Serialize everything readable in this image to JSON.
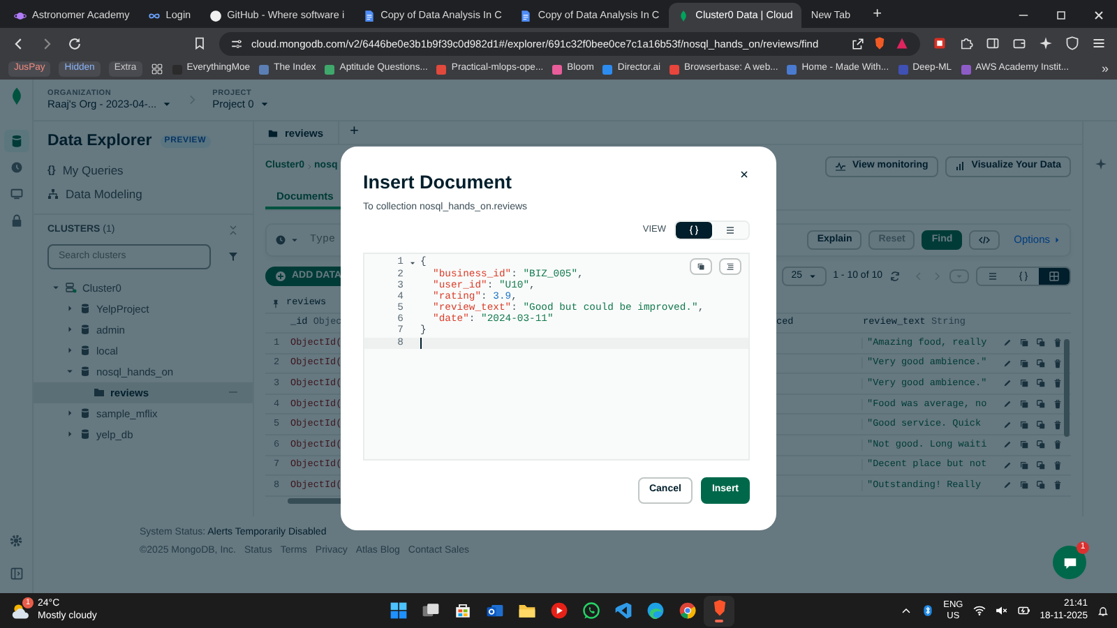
{
  "browser": {
    "tabs": [
      {
        "title": "Astronomer Academy",
        "kind": "astro",
        "selected": false
      },
      {
        "title": "Login",
        "kind": "login",
        "selected": false
      },
      {
        "title": "GitHub - Where software i",
        "kind": "github",
        "selected": false
      },
      {
        "title": "Copy of Data Analysis In C",
        "kind": "doc",
        "selected": false
      },
      {
        "title": "Copy of Data Analysis In C",
        "kind": "doc",
        "selected": false
      },
      {
        "title": "Cluster0 Data | Cloud",
        "kind": "mongo",
        "selected": true
      },
      {
        "title": "New Tab",
        "kind": "blank",
        "selected": false
      }
    ],
    "new_tab": "+",
    "url": "cloud.mongodb.com/v2/6446be0e3b1b9f39c0d982d1#/explorer/691c32f0bee0ce7c1a16b53f/nosql_hands_on/reviews/find",
    "bookmark_tags": [
      {
        "label": "JusPay",
        "color": "#f28b82"
      },
      {
        "label": "Hidden",
        "color": "#8ab4f8"
      },
      {
        "label": "Extra",
        "color": "#c8c8c8"
      }
    ],
    "bookmarks": [
      {
        "label": "EverythingMoe",
        "color": "#2b2b2b"
      },
      {
        "label": "The Index",
        "color": "#5b7fb5"
      },
      {
        "label": "Aptitude Questions...",
        "color": "#3fa86b"
      },
      {
        "label": "Practical-mlops-ope...",
        "color": "#e0493b"
      },
      {
        "label": "Bloom",
        "color": "#e85d9a"
      },
      {
        "label": "Director.ai",
        "color": "#2d8cf0"
      },
      {
        "label": "Browserbase: A web...",
        "color": "#e8453c"
      },
      {
        "label": "Home - Made With...",
        "color": "#4a7bd0"
      },
      {
        "label": "Deep-ML",
        "color": "#3f51b5"
      },
      {
        "label": "AWS Academy Instit...",
        "color": "#8e5cc7"
      }
    ],
    "more": "»"
  },
  "atlas": {
    "organization": {
      "label": "ORGANIZATION",
      "value": "Raaj's Org - 2023-04-..."
    },
    "project": {
      "label": "PROJECT",
      "value": "Project 0"
    },
    "rail": [
      {
        "kind": "database",
        "selected": true
      },
      {
        "kind": "clock",
        "selected": false
      },
      {
        "kind": "monitor",
        "selected": false
      },
      {
        "kind": "lock",
        "selected": false
      }
    ],
    "sidebar": {
      "title": "Data Explorer",
      "badge": "PREVIEW",
      "links": [
        {
          "kind": "queries",
          "icon": "{}",
          "label": "My Queries"
        },
        {
          "kind": "modeling",
          "label": "Data Modeling"
        }
      ],
      "clusters_label": "CLUSTERS",
      "clusters_count": "(1)",
      "search_placeholder": "Search clusters",
      "tree": [
        {
          "label": "Cluster0",
          "kind": "cluster",
          "expanded": true,
          "selected": false,
          "children": [
            {
              "label": "YelpProject",
              "kind": "database",
              "expanded": false,
              "selected": false
            },
            {
              "label": "admin",
              "kind": "database",
              "expanded": false,
              "selected": false
            },
            {
              "label": "local",
              "kind": "database",
              "expanded": false,
              "selected": false
            },
            {
              "label": "nosql_hands_on",
              "kind": "database",
              "expanded": true,
              "selected": false,
              "children": [
                {
                  "label": "reviews",
                  "kind": "collection",
                  "selected": true
                }
              ]
            },
            {
              "label": "sample_mflix",
              "kind": "database",
              "expanded": false,
              "selected": false
            },
            {
              "label": "yelp_db",
              "kind": "database",
              "expanded": false,
              "selected": false
            }
          ]
        }
      ]
    },
    "main": {
      "collection_tabs": [
        {
          "label": "reviews",
          "selected": true
        }
      ],
      "add_tab": "+",
      "breadcrumb": [
        "Cluster0",
        "nosq"
      ],
      "header_buttons": [
        {
          "kind": "monitoring",
          "label": "View monitoring"
        },
        {
          "kind": "visualize",
          "label": "Visualize Your Data"
        }
      ],
      "view_tabs": [
        {
          "label": "Documents",
          "selected": true
        }
      ],
      "filter_placeholder": "Type",
      "query_buttons": [
        {
          "kind": "default",
          "label": "Explain",
          "disabled": false
        },
        {
          "kind": "default",
          "label": "Reset",
          "disabled": true
        },
        {
          "kind": "primary",
          "label": "Find",
          "disabled": false
        },
        {
          "kind": "code",
          "disabled": false
        }
      ],
      "options": "Options",
      "add_data": "ADD DATA",
      "page_size": "25",
      "page_range": "1 - 10 of 10",
      "view_modes": [
        {
          "kind": "list",
          "selected": false
        },
        {
          "kind": "json",
          "selected": false
        },
        {
          "kind": "table",
          "selected": true
        }
      ],
      "table": {
        "collection": "reviews",
        "columns": [
          {
            "name": "_id",
            "type": "Objec"
          },
          {
            "name": "ced"
          },
          {
            "name": "review_text",
            "type": "String"
          }
        ],
        "rows": [
          {
            "number": "1",
            "id": "ObjectId(",
            "review_text": "\"Amazing food, really"
          },
          {
            "number": "2",
            "id": "ObjectId(",
            "review_text": "\"Very good ambience.\""
          },
          {
            "number": "3",
            "id": "ObjectId(",
            "review_text": "\"Very good ambience.\""
          },
          {
            "number": "4",
            "id": "ObjectId(",
            "review_text": "\"Food was average, no"
          },
          {
            "number": "5",
            "id": "ObjectId(",
            "review_text": "\"Good service. Quick"
          },
          {
            "number": "6",
            "id": "ObjectId(",
            "review_text": "\"Not good. Long waiti"
          },
          {
            "number": "7",
            "id": "ObjectId(",
            "review_text": "\"Decent place but not"
          },
          {
            "number": "8",
            "id": "ObjectId(",
            "review_text": "\"Outstanding! Really"
          }
        ]
      }
    },
    "footer": {
      "status_label": "System Status:",
      "status_value": "Alerts Temporarily Disabled",
      "copyright": "©2025 MongoDB, Inc.",
      "links": [
        "Status",
        "Terms",
        "Privacy",
        "Atlas Blog",
        "Contact Sales"
      ]
    },
    "chat_badge": "1"
  },
  "modal": {
    "title": "Insert Document",
    "subtitle": "To collection nosql_hands_on.reviews",
    "view_label": "VIEW",
    "view_modes": [
      {
        "kind": "json",
        "selected": true
      },
      {
        "kind": "list",
        "selected": false
      }
    ],
    "lines": [
      {
        "number": "1",
        "fold": true,
        "indented": false,
        "active": false,
        "tokens": [
          {
            "kind": "punct",
            "text": "{"
          }
        ]
      },
      {
        "number": "2",
        "fold": false,
        "indented": true,
        "active": false,
        "tokens": [
          {
            "kind": "key",
            "text": "\"business_id\""
          },
          {
            "kind": "punct",
            "text": ": "
          },
          {
            "kind": "string",
            "text": "\"BIZ_005\""
          },
          {
            "kind": "punct",
            "text": ","
          }
        ]
      },
      {
        "number": "3",
        "fold": false,
        "indented": true,
        "active": false,
        "tokens": [
          {
            "kind": "key",
            "text": "\"user_id\""
          },
          {
            "kind": "punct",
            "text": ": "
          },
          {
            "kind": "string",
            "text": "\"U10\""
          },
          {
            "kind": "punct",
            "text": ","
          }
        ]
      },
      {
        "number": "4",
        "fold": false,
        "indented": true,
        "active": false,
        "tokens": [
          {
            "kind": "key",
            "text": "\"rating\""
          },
          {
            "kind": "punct",
            "text": ": "
          },
          {
            "kind": "number",
            "text": "3.9"
          },
          {
            "kind": "punct",
            "text": ","
          }
        ]
      },
      {
        "number": "5",
        "fold": false,
        "indented": true,
        "active": false,
        "tokens": [
          {
            "kind": "key",
            "text": "\"review_text\""
          },
          {
            "kind": "punct",
            "text": ": "
          },
          {
            "kind": "string",
            "text": "\"Good but could be improved.\""
          },
          {
            "kind": "punct",
            "text": ","
          }
        ]
      },
      {
        "number": "6",
        "fold": false,
        "indented": true,
        "active": false,
        "tokens": [
          {
            "kind": "key",
            "text": "\"date\""
          },
          {
            "kind": "punct",
            "text": ": "
          },
          {
            "kind": "string",
            "text": "\"2024-03-11\""
          }
        ]
      },
      {
        "number": "7",
        "fold": false,
        "indented": false,
        "active": false,
        "tokens": [
          {
            "kind": "punct",
            "text": "}"
          }
        ]
      },
      {
        "number": "8",
        "fold": false,
        "indented": false,
        "active": true
      }
    ],
    "buttons": [
      {
        "kind": "secondary",
        "label": "Cancel"
      },
      {
        "kind": "primary",
        "label": "Insert"
      }
    ]
  },
  "taskbar": {
    "weather": {
      "temp": "24°C",
      "condition": "Mostly cloudy",
      "badge": "1"
    },
    "apps": [
      {
        "kind": "start",
        "active": false
      },
      {
        "kind": "taskview",
        "active": false
      },
      {
        "kind": "store",
        "active": false
      },
      {
        "kind": "mail",
        "active": false
      },
      {
        "kind": "files",
        "active": false
      },
      {
        "kind": "youtube",
        "active": false
      },
      {
        "kind": "whatsapp",
        "active": false
      },
      {
        "kind": "vscode",
        "active": false
      },
      {
        "kind": "edge",
        "active": false
      },
      {
        "kind": "chrome",
        "active": false
      },
      {
        "kind": "brave",
        "active": true
      }
    ],
    "language": "ENG",
    "region": "US",
    "time": "21:41",
    "date": "18-11-2025"
  }
}
